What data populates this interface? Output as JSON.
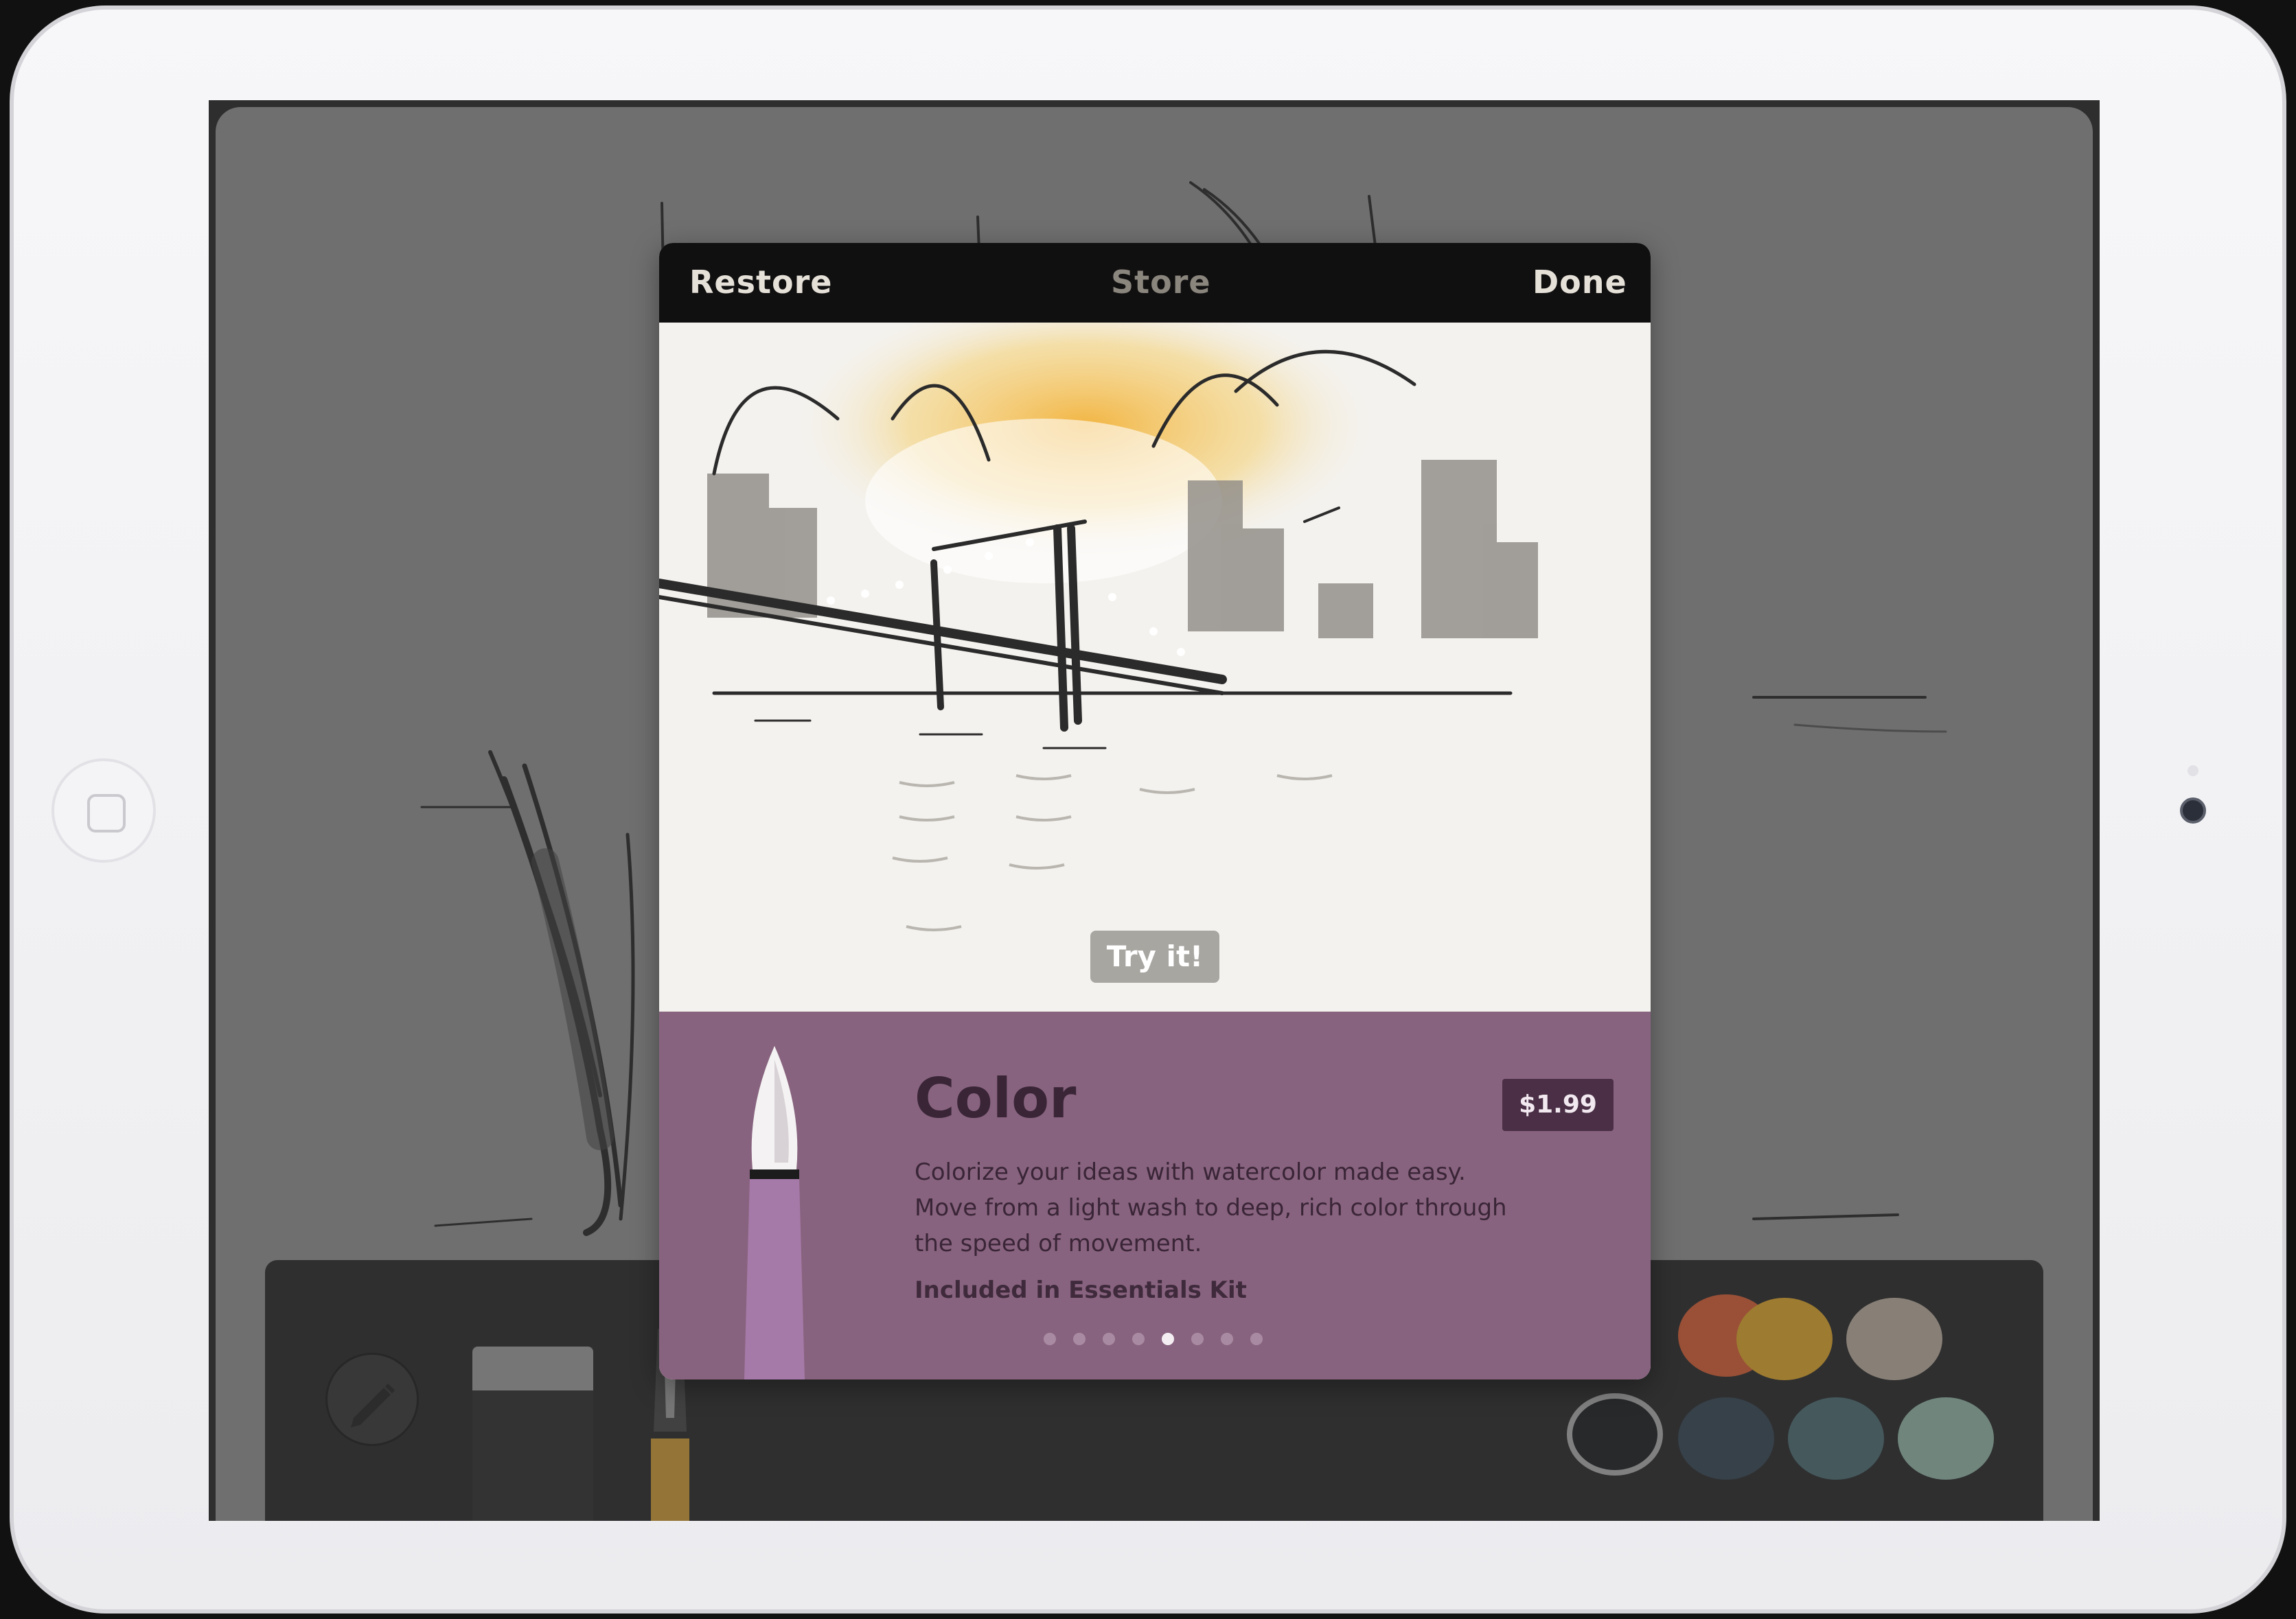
{
  "store": {
    "restore_label": "Restore",
    "title": "Store",
    "done_label": "Done",
    "try_label": "Try it!"
  },
  "product": {
    "name": "Color",
    "price": "$1.99",
    "description": "Colorize your ideas with watercolor made easy. Move from a light wash to deep, rich color through the speed of movement.",
    "kit": "Included in Essentials Kit",
    "page_count": 8,
    "active_page": 5
  },
  "palette": {
    "colors": [
      "#c0502a",
      "#c7921f",
      "#a69a8c",
      "#111417",
      "#2a3a46",
      "#3f5e64",
      "#82a496"
    ],
    "selected": "#111417"
  },
  "icons": {
    "pencil": "pencil-icon",
    "home": "home-button-icon"
  }
}
